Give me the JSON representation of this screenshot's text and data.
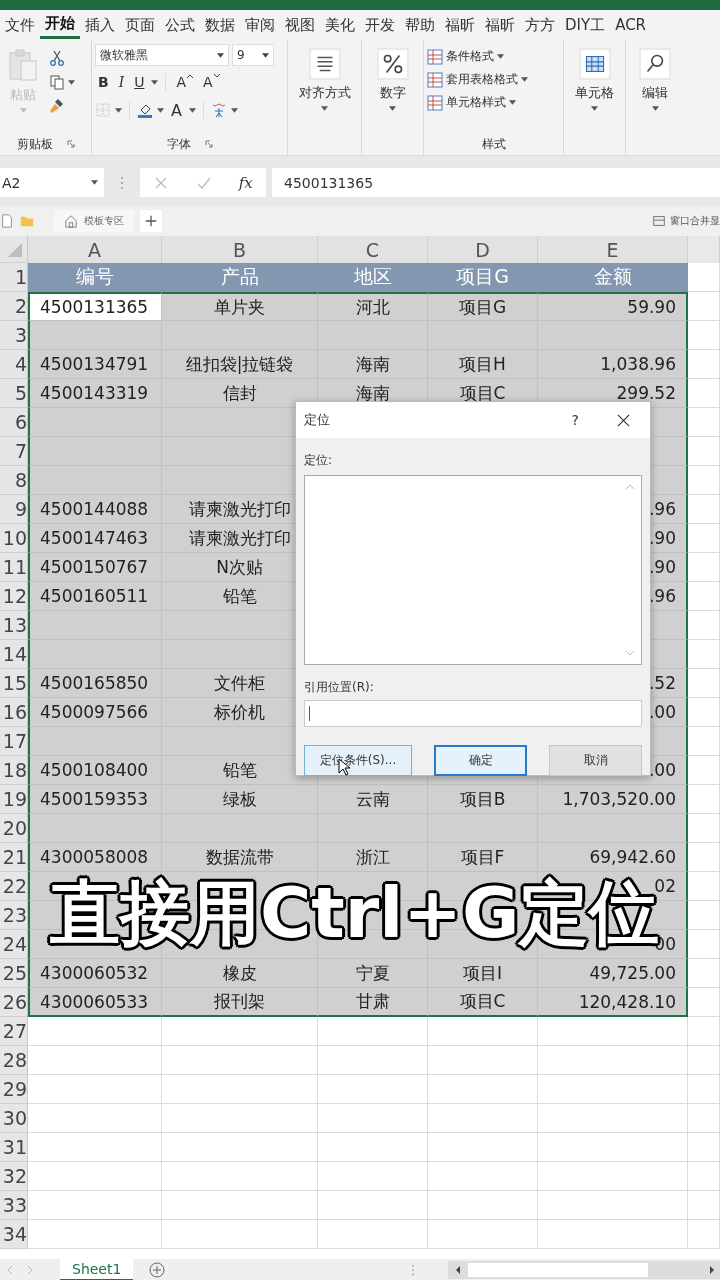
{
  "ribbon": {
    "tabs": [
      {
        "label": "文件",
        "selected": false
      },
      {
        "label": "开始",
        "selected": true
      },
      {
        "label": "插入",
        "selected": false
      },
      {
        "label": "页面",
        "selected": false
      },
      {
        "label": "公式",
        "selected": false
      },
      {
        "label": "数据",
        "selected": false
      },
      {
        "label": "审阅",
        "selected": false
      },
      {
        "label": "视图",
        "selected": false
      },
      {
        "label": "美化",
        "selected": false
      },
      {
        "label": "开发",
        "selected": false
      },
      {
        "label": "帮助",
        "selected": false
      },
      {
        "label": "福昕",
        "selected": false
      },
      {
        "label": "福昕",
        "selected": false
      },
      {
        "label": "方方",
        "selected": false
      },
      {
        "label": "DIY工",
        "selected": false
      },
      {
        "label": "ACR",
        "selected": false
      }
    ],
    "clipboard": {
      "paste": "粘贴",
      "label": "剪贴板"
    },
    "font": {
      "name": "微软雅黑",
      "size": "9",
      "bold": "B",
      "italic": "I",
      "underline": "U",
      "grow": "A",
      "shrink": "A",
      "color_button": "A",
      "label": "字体"
    },
    "alignment": "对齐方式",
    "number": "数字",
    "styles": {
      "items": [
        "条件格式",
        "套用表格格式",
        "单元格样式"
      ],
      "label": "样式"
    },
    "cells": "单元格",
    "editing": "编辑"
  },
  "formula_bar": {
    "name_box": "A2",
    "fx": "fx",
    "formula": "4500131365"
  },
  "workbook_bar": {
    "tab": "模板专区",
    "window_merge": "窗口合并显"
  },
  "sheet": {
    "columns": [
      "A",
      "B",
      "C",
      "D",
      "E"
    ],
    "header": {
      "number": "1",
      "cells": {
        "a": "编号",
        "b": "产品",
        "c": "地区",
        "d": "项目G",
        "e": "金额"
      }
    },
    "rows": [
      {
        "number": "2",
        "selected": true,
        "active": true,
        "cells": {
          "a": "4500131365",
          "b": "单片夹",
          "c": "河北",
          "d": "项目G",
          "e": "59.90"
        }
      },
      {
        "number": "3",
        "selected": true,
        "active": false
      },
      {
        "number": "4",
        "selected": true,
        "active": false,
        "cells": {
          "a": "4500134791",
          "b": "纽扣袋|拉链袋",
          "c": "海南",
          "d": "项目H",
          "e": "1,038.96"
        }
      },
      {
        "number": "5",
        "selected": true,
        "active": false,
        "cells": {
          "a": "4500143319",
          "b": "信封",
          "c": "海南",
          "d": "项目C",
          "e": "299.52"
        }
      },
      {
        "number": "6",
        "selected": true,
        "active": false
      },
      {
        "number": "7",
        "selected": true,
        "active": false
      },
      {
        "number": "8",
        "selected": true,
        "active": false
      },
      {
        "number": "9",
        "selected": true,
        "active": false,
        "cells": {
          "a": "4500144088",
          "b": "请柬激光打印",
          "e": ".96"
        }
      },
      {
        "number": "10",
        "selected": true,
        "active": false,
        "cells": {
          "a": "4500147463",
          "b": "请柬激光打印",
          "e": ".90"
        }
      },
      {
        "number": "11",
        "selected": true,
        "active": false,
        "cells": {
          "a": "4500150767",
          "b": "N次贴",
          "e": ".90"
        }
      },
      {
        "number": "12",
        "selected": true,
        "active": false,
        "cells": {
          "a": "4500160511",
          "b": "铅笔",
          "e": ".96"
        }
      },
      {
        "number": "13",
        "selected": true,
        "active": false
      },
      {
        "number": "14",
        "selected": true,
        "active": false
      },
      {
        "number": "15",
        "selected": true,
        "active": false,
        "cells": {
          "a": "4500165850",
          "b": "文件柜",
          "e": ".52"
        }
      },
      {
        "number": "16",
        "selected": true,
        "active": false,
        "cells": {
          "a": "4500097566",
          "b": "标价机",
          "e": ".00"
        }
      },
      {
        "number": "17",
        "selected": true,
        "active": false
      },
      {
        "number": "18",
        "selected": true,
        "active": false,
        "cells": {
          "a": "4500108400",
          "b": "铅笔",
          "e": ".00"
        }
      },
      {
        "number": "19",
        "selected": true,
        "active": false,
        "cells": {
          "a": "4500159353",
          "b": "绿板",
          "c": "云南",
          "d": "项目B",
          "e": "1,703,520.00"
        }
      },
      {
        "number": "20",
        "selected": true,
        "active": false
      },
      {
        "number": "21",
        "selected": true,
        "active": false,
        "cells": {
          "a": "4300058008",
          "b": "数据流带",
          "c": "浙江",
          "d": "项目F",
          "e": "69,942.60"
        }
      },
      {
        "number": "22",
        "selected": true,
        "active": false,
        "cells": {
          "e": "02"
        }
      },
      {
        "number": "23",
        "selected": true,
        "active": false
      },
      {
        "number": "24",
        "selected": true,
        "active": false,
        "cells": {
          "e": "00"
        }
      },
      {
        "number": "25",
        "selected": true,
        "active": false,
        "cells": {
          "a": "4300060532",
          "b": "橡皮",
          "c": "宁夏",
          "d": "项目I",
          "e": "49,725.00"
        }
      },
      {
        "number": "26",
        "selected": true,
        "active": false,
        "cells": {
          "a": "4300060533",
          "b": "报刊架",
          "c": "甘肃",
          "d": "项目C",
          "e": "120,428.10"
        }
      },
      {
        "number": "27",
        "selected": false
      },
      {
        "number": "28",
        "selected": false
      },
      {
        "number": "29",
        "selected": false
      },
      {
        "number": "30",
        "selected": false
      },
      {
        "number": "31",
        "selected": false
      },
      {
        "number": "32",
        "selected": false
      },
      {
        "number": "33",
        "selected": false
      },
      {
        "number": "34",
        "selected": false
      }
    ]
  },
  "dialog": {
    "title": "定位",
    "help": "?",
    "list_label": "定位:",
    "reference_label": "引用位置(R):",
    "buttons": [
      {
        "label": "定位条件(S)...",
        "default": false
      },
      {
        "label": "确定",
        "default": true
      },
      {
        "label": "取消",
        "default": false
      }
    ]
  },
  "caption": "直接用Ctrl+G定位",
  "sheet_tabs": [
    {
      "label": "Sheet1",
      "selected": true
    }
  ]
}
